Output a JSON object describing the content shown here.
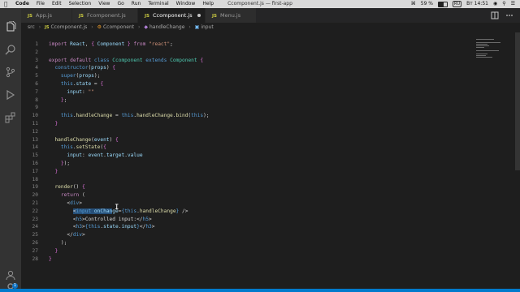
{
  "menubar": {
    "app_name": "Code",
    "menus": [
      "File",
      "Edit",
      "Selection",
      "View",
      "Go",
      "Run",
      "Terminal",
      "Window",
      "Help"
    ],
    "window_title": "Ccomponent.js — first-app",
    "battery": "59 %",
    "keyboard_layout": "RU",
    "clock": "Вт 14:51"
  },
  "tabs": [
    {
      "label": "App.js",
      "active": false
    },
    {
      "label": "Fcomponent.js",
      "active": false
    },
    {
      "label": "Ccomponent.js",
      "active": true,
      "modified": true
    },
    {
      "label": "Menu.js",
      "active": false
    }
  ],
  "tab_type_badge": "JS",
  "breadcrumb": {
    "folder": "src",
    "file": "Ccomponent.js",
    "class": "Ccomponent",
    "method": "handleChange",
    "variable": "input"
  },
  "activity_badge": "1",
  "editor": {
    "line_numbers": [
      "1",
      "2",
      "3",
      "4",
      "5",
      "6",
      "7",
      "8",
      "9",
      "10",
      "11",
      "12",
      "13",
      "14",
      "15",
      "16",
      "17",
      "18",
      "19",
      "20",
      "21",
      "22",
      "23",
      "24",
      "25",
      "26",
      "27",
      "28"
    ]
  },
  "colors": {
    "editor_bg": "#1e1e1e",
    "status_bar": "#007acc",
    "accent": "#0e70c0"
  }
}
